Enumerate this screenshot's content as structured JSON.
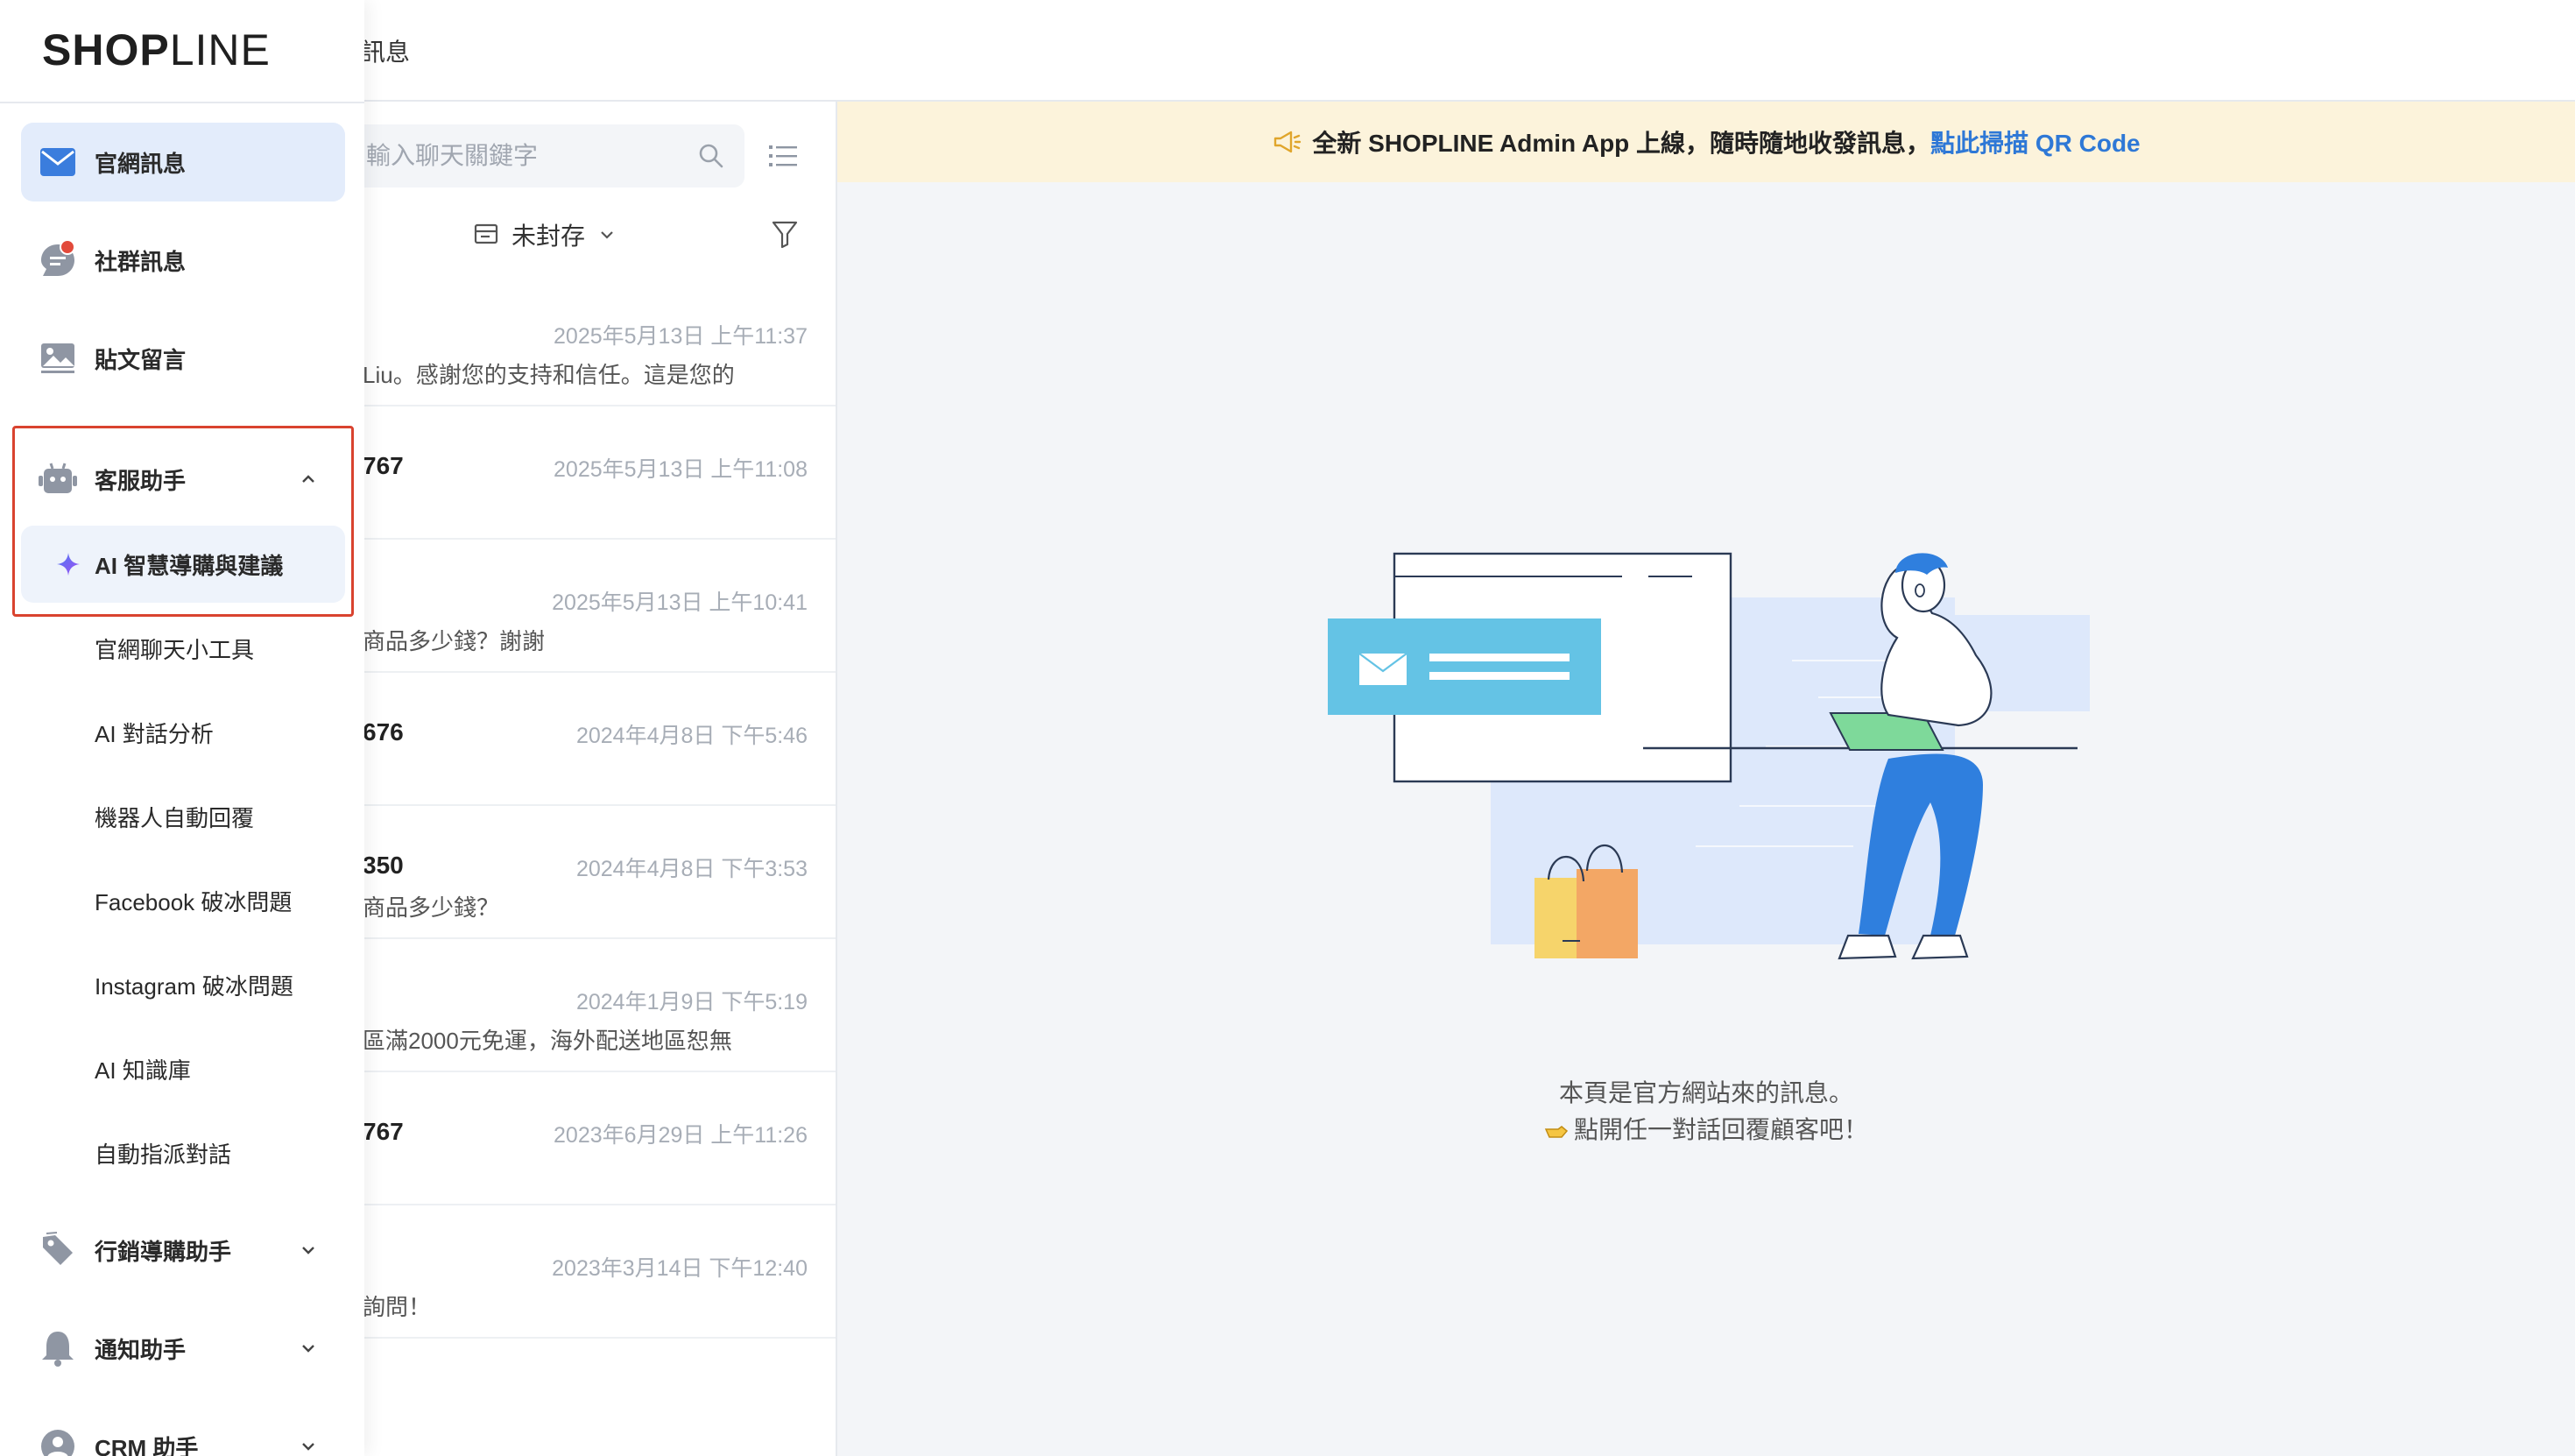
{
  "header": {
    "page_title": "訊息"
  },
  "sidebar": {
    "logo_strong": "SHOP",
    "logo_light": "LINE",
    "items": [
      {
        "label": "官網訊息",
        "icon": "mail-icon",
        "active": true
      },
      {
        "label": "社群訊息",
        "icon": "chat-bubble-icon",
        "badge": true
      },
      {
        "label": "貼文留言",
        "icon": "image-post-icon"
      },
      {
        "label": "客服助手",
        "icon": "robot-icon",
        "expanded": true
      },
      {
        "label": "行銷導購助手",
        "icon": "tag-icon"
      },
      {
        "label": "通知助手",
        "icon": "bell-icon"
      },
      {
        "label": "CRM 助手",
        "icon": "user-icon"
      }
    ],
    "sub_items": [
      {
        "label": "AI 智慧導購與建議",
        "active": true,
        "icon": "sparkle-icon"
      },
      {
        "label": "官網聊天小工具"
      },
      {
        "label": "AI 對話分析"
      },
      {
        "label": "機器人自動回覆"
      },
      {
        "label": "Facebook 破冰問題"
      },
      {
        "label": "Instagram 破冰問題"
      },
      {
        "label": "AI 知識庫"
      },
      {
        "label": "自動指派對話"
      }
    ]
  },
  "chat_list": {
    "search_placeholder": "輸入聊天關鍵字",
    "filter_label": "未封存",
    "rows": [
      {
        "name": "",
        "time": "2025年5月13日 上午11:37",
        "preview": "Liu。感謝您的支持和信任。這是您的"
      },
      {
        "name": "767",
        "time": "2025年5月13日 上午11:08",
        "preview": ""
      },
      {
        "name": "",
        "time": "2025年5月13日 上午10:41",
        "preview": "商品多少錢？謝謝"
      },
      {
        "name": "676",
        "time": "2024年4月8日 下午5:46",
        "preview": ""
      },
      {
        "name": "350",
        "time": "2024年4月8日 下午3:53",
        "preview": "商品多少錢？"
      },
      {
        "name": "",
        "time": "2024年1月9日 下午5:19",
        "preview": "區滿2000元免運，海外配送地區恕無"
      },
      {
        "name": "767",
        "time": "2023年6月29日 上午11:26",
        "preview": ""
      },
      {
        "name": "",
        "time": "2023年3月14日 下午12:40",
        "preview": "詢問！"
      }
    ]
  },
  "main": {
    "banner_text": "全新 SHOPLINE Admin App 上線，隨時隨地收發訊息，",
    "banner_link": "點此掃描 QR Code",
    "empty_line1": "本頁是官方網站來的訊息。",
    "empty_line2": "點開任一對話回覆顧客吧！"
  },
  "colors": {
    "accent": "#2e78d6",
    "active_bg": "#e3ecfb",
    "highlight_border": "#d9432f",
    "banner_bg": "#fcf3db",
    "badge_red": "#e24a3b"
  }
}
